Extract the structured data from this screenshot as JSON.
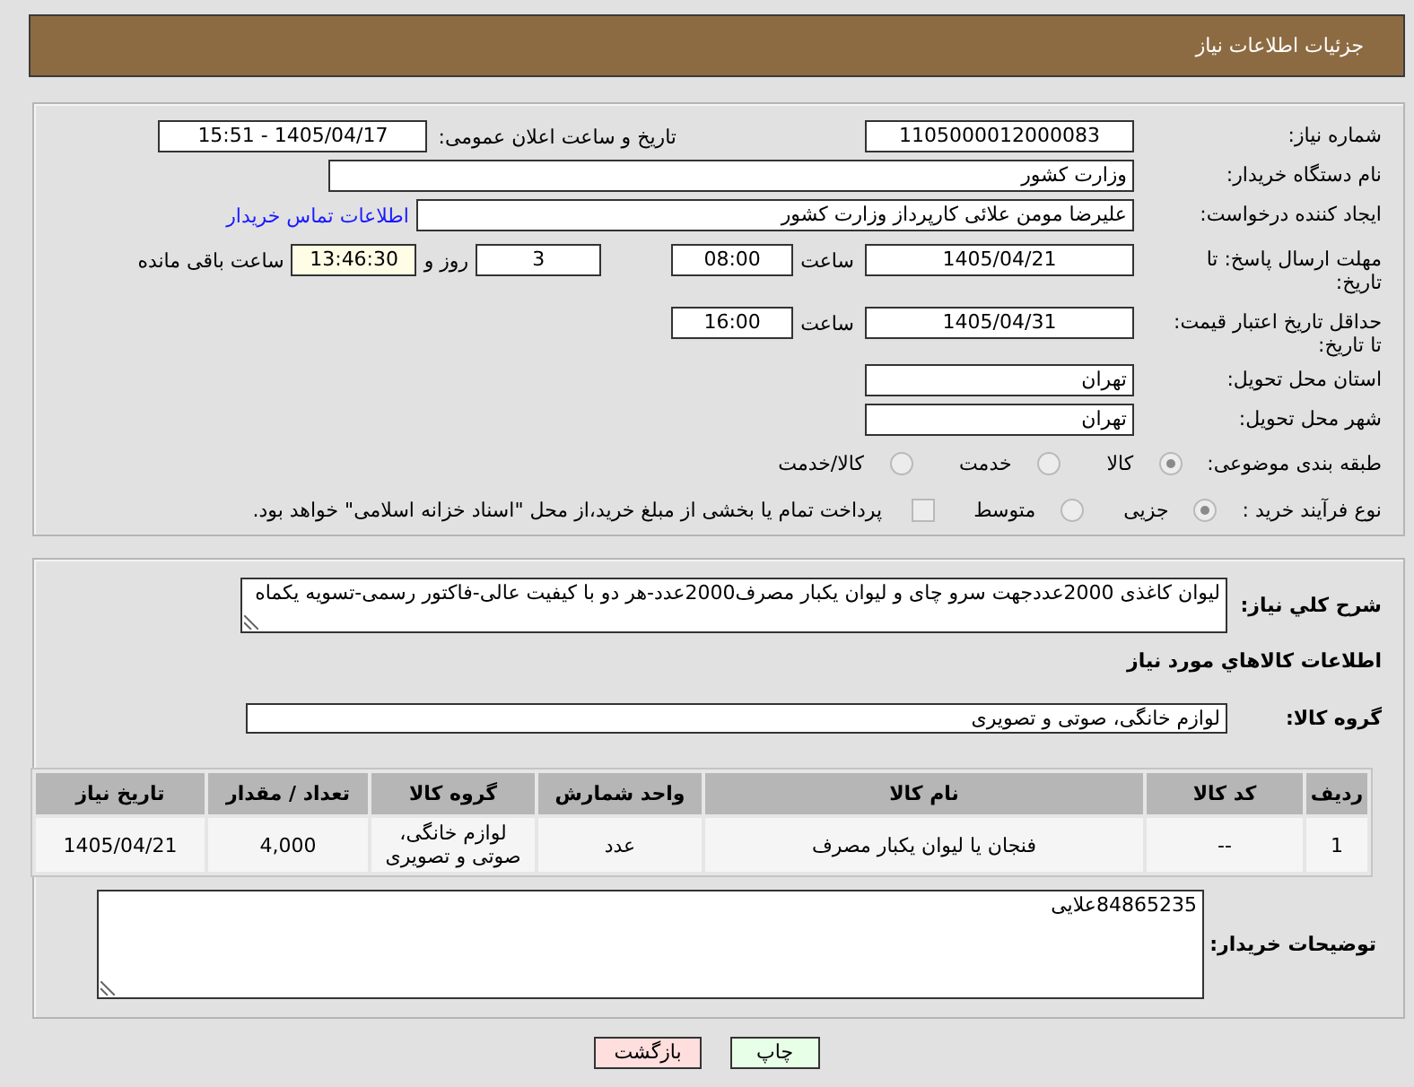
{
  "header": {
    "title": "جزئیات اطلاعات نیاز"
  },
  "details": {
    "need_number": {
      "label": "شماره نیاز:",
      "value": "1105000012000083"
    },
    "announcement": {
      "label": "تاریخ و ساعت اعلان عمومی:",
      "value": "1405/04/17 - 15:51"
    },
    "buyer_org": {
      "label": "نام دستگاه خریدار:",
      "value": "وزارت کشور"
    },
    "requester": {
      "label": "ایجاد کننده درخواست:",
      "value": "علیرضا مومن علائی کارپرداز وزارت کشور",
      "link": "اطلاعات تماس خریدار"
    },
    "response_deadline": {
      "label": "مهلت ارسال پاسخ: تا تاریخ:",
      "date": "1405/04/21",
      "time_label": "ساعت",
      "time": "08:00",
      "days": "3",
      "days_label": "روز و",
      "remaining": "13:46:30",
      "remaining_label": "ساعت باقی مانده"
    },
    "price_validity": {
      "label": "حداقل تاریخ اعتبار قیمت: تا تاریخ:",
      "date": "1405/04/31",
      "time_label": "ساعت",
      "time": "16:00"
    },
    "province": {
      "label": "استان محل تحویل:",
      "value": "تهران"
    },
    "city": {
      "label": "شهر محل تحویل:",
      "value": "تهران"
    },
    "category": {
      "label": "طبقه بندی موضوعی:",
      "options": [
        {
          "label": "کالا",
          "selected": true
        },
        {
          "label": "خدمت",
          "selected": false
        },
        {
          "label": "کالا/خدمت",
          "selected": false
        }
      ]
    },
    "process": {
      "label": "نوع فرآیند خرید :",
      "options": [
        {
          "label": "جزیی",
          "selected": true
        },
        {
          "label": "متوسط",
          "selected": false
        }
      ],
      "treasury": {
        "label": "پرداخت تمام یا بخشی از مبلغ خرید،از محل \"اسناد خزانه اسلامی\" خواهد بود.",
        "checked": false
      }
    }
  },
  "needs": {
    "description": {
      "label": "شرح کلي نياز:",
      "value": "لیوان کاغذی 2000عددجهت سرو چای و لیوان یکبار مصرف2000عدد-هر دو با کیفیت عالی-فاکتور رسمی-تسویه یکماه"
    },
    "section_title": "اطلاعات کالاهاي مورد نياز",
    "goods_group": {
      "label": "گروه کالا:",
      "value": "لوازم خانگی، صوتی و تصویری"
    },
    "table": {
      "columns": [
        "ردیف",
        "کد کالا",
        "نام کالا",
        "واحد شمارش",
        "گروه کالا",
        "تعداد / مقدار",
        "تاریخ نیاز"
      ],
      "rows": [
        [
          "1",
          "--",
          "فنجان یا لیوان یکبار مصرف",
          "عدد",
          "لوازم خانگی، صوتی و تصویری",
          "4,000",
          "1405/04/21"
        ]
      ]
    },
    "buyer_notes": {
      "label": "توضیحات خریدار:",
      "value": "84865235علایی"
    }
  },
  "buttons": [
    {
      "label": "چاپ",
      "kind": "print"
    },
    {
      "label": "بازگشت",
      "kind": "back"
    }
  ]
}
